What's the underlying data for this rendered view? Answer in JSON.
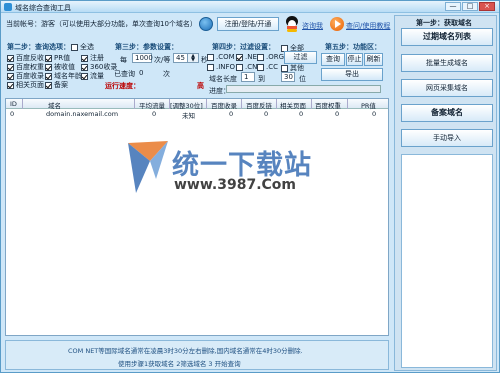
{
  "window": {
    "title": "域名综合查询工具",
    "buttons": [
      "—",
      "□",
      "×"
    ]
  },
  "header": {
    "account_text": "当前帐号：游客（可以使用大部分功能，单次查询10个域名）",
    "register_button": "注册/登陆/开通",
    "contact_link": "咨询我",
    "help_link": "查问/使用教程"
  },
  "step2": {
    "title": "第二步：查询选项：",
    "select_all": "全选",
    "options": [
      {
        "label": "百度反收",
        "checked": true
      },
      {
        "label": "PR值",
        "checked": true
      },
      {
        "label": "注册",
        "checked": true
      },
      {
        "label": "百度权重",
        "checked": true
      },
      {
        "label": "被收值",
        "checked": true
      },
      {
        "label": "360收录",
        "checked": true
      },
      {
        "label": "百度收录",
        "checked": true
      },
      {
        "label": "域名年龄",
        "checked": true
      },
      {
        "label": "流量",
        "checked": true
      },
      {
        "label": "相关页面",
        "checked": true
      },
      {
        "label": "备案",
        "checked": true
      }
    ]
  },
  "step3": {
    "title": "第三步：参数设置：",
    "every_label": "每",
    "count_value": "1000",
    "times_label": "次/等",
    "seconds_value": "45",
    "seconds_unit": "秒",
    "queried_label": "已查询",
    "queried_value": "0",
    "queried_unit": "次",
    "running_label": "运行速度：",
    "speed_value": "高"
  },
  "step4": {
    "title": "第四步：过滤设置：",
    "all_label": "全部",
    "filters": [
      {
        "label": ".COM",
        "checked": false
      },
      {
        "label": ".NET",
        "checked": true
      },
      {
        "label": ".ORG",
        "checked": false
      },
      {
        "label": ".INFO",
        "checked": false
      },
      {
        "label": ".CN",
        "checked": false
      },
      {
        "label": ".CC",
        "checked": false
      },
      {
        "label": "其他",
        "checked": false
      }
    ],
    "filter_button": "过滤",
    "length_label": "域名长度",
    "length_from": "1",
    "length_to_label": "到",
    "length_to": "30",
    "length_unit": "位",
    "progress_label": "进度："
  },
  "step5": {
    "title": "第五步：功能区：",
    "query_button": "查询",
    "stop_button": "停止",
    "refresh_button": "刷新",
    "export_button": "导出"
  },
  "table": {
    "headers": [
      "ID",
      "域名",
      "平均流量",
      "[调整30位]",
      "百度收录",
      "百度反链",
      "相关页面",
      "百度权重",
      "PR值"
    ],
    "rows": [
      [
        "0",
        "domain.naxemail.com",
        "0",
        "未知",
        "0",
        "0",
        "0",
        "0",
        "0"
      ]
    ]
  },
  "watermark": {
    "text": "统一下载站",
    "url": "www.3987.Com"
  },
  "status": {
    "line1": "COM NET等国际域名通常在凌晨3时30分左右删除,国内域名通常在4时30分删除.",
    "line2": "使用步骤1获取域名 2筛选域名 3 开始查询"
  },
  "right_panel": {
    "title": "第一步：获取域名",
    "buttons": [
      "过期域名列表",
      "批量生成域名",
      "网页采集域名",
      "备案域名",
      "手动导入"
    ]
  },
  "colors": {
    "accent": "#2d8fd6",
    "warning_text": "#b00000",
    "watermark_blue": "#3a6fb5"
  }
}
